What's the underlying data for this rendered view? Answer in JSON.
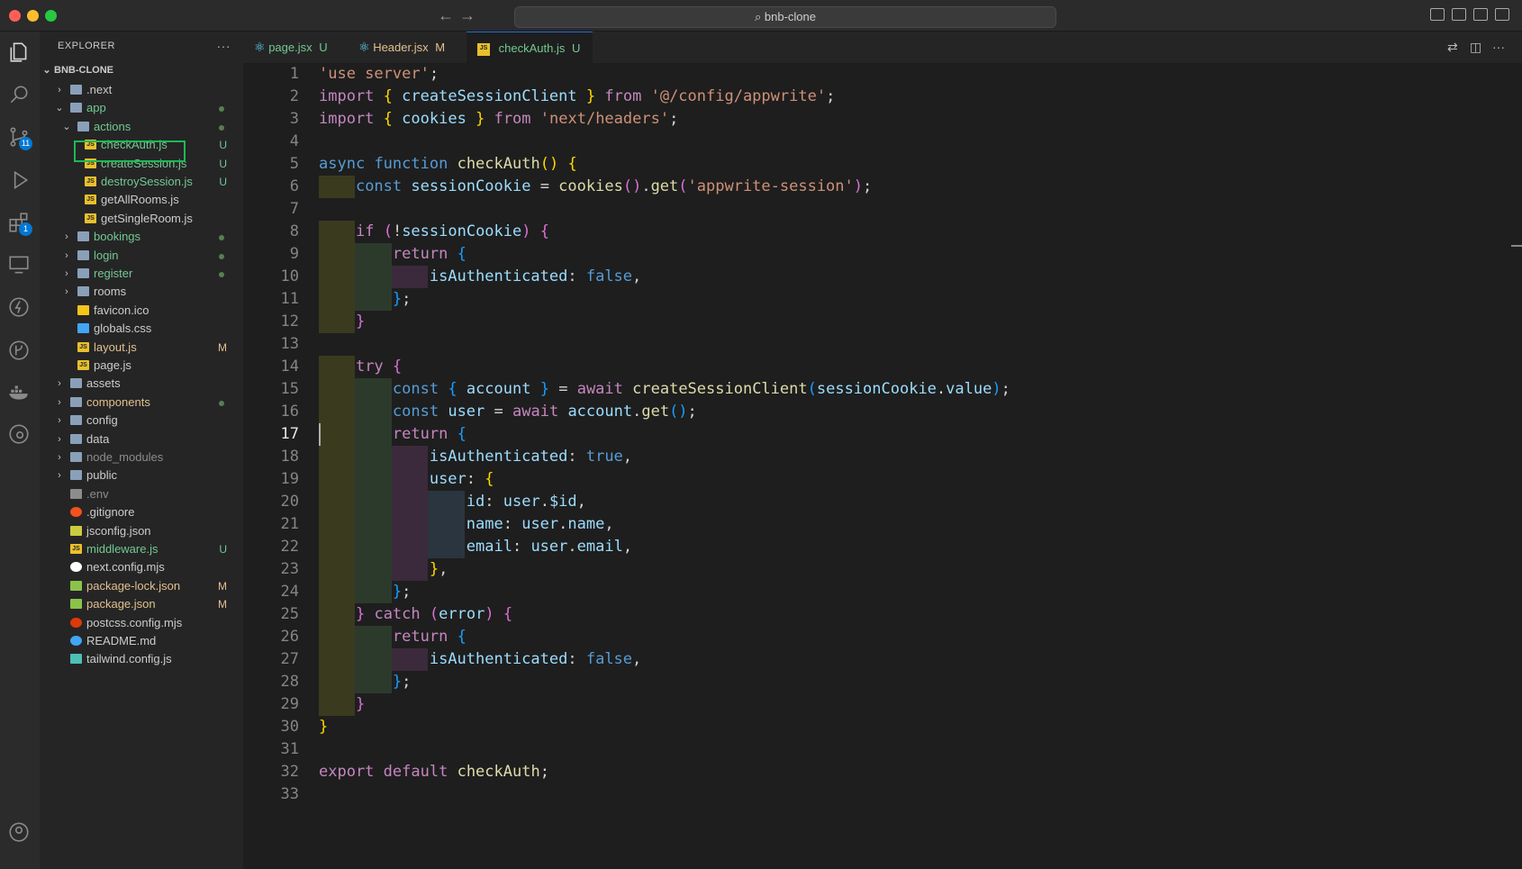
{
  "window": {
    "title": "bnb-clone"
  },
  "explorer": {
    "header": "EXPLORER",
    "more": "···",
    "root": "BNB-CLONE",
    "items": [
      {
        "label": ".next",
        "level": 1,
        "type": "folder",
        "open": false,
        "status": "",
        "dot": false,
        "color": "#cccccc"
      },
      {
        "label": "app",
        "level": 1,
        "type": "folder",
        "open": true,
        "status": "",
        "dot": true,
        "color": "#73c991"
      },
      {
        "label": "actions",
        "level": 2,
        "type": "folder",
        "open": true,
        "status": "",
        "dot": true,
        "color": "#73c991"
      },
      {
        "label": "checkAuth.js",
        "level": 3,
        "type": "js",
        "status": "U",
        "dot": false,
        "color": "#73c991",
        "selected": true
      },
      {
        "label": "createSession.js",
        "level": 3,
        "type": "js",
        "status": "U",
        "dot": false,
        "color": "#73c991"
      },
      {
        "label": "destroySession.js",
        "level": 3,
        "type": "js",
        "status": "U",
        "dot": false,
        "color": "#73c991"
      },
      {
        "label": "getAllRooms.js",
        "level": 3,
        "type": "js",
        "status": "",
        "dot": false,
        "color": "#cccccc"
      },
      {
        "label": "getSingleRoom.js",
        "level": 3,
        "type": "js",
        "status": "",
        "dot": false,
        "color": "#cccccc"
      },
      {
        "label": "bookings",
        "level": 2,
        "type": "folder",
        "open": false,
        "status": "",
        "dot": true,
        "color": "#73c991"
      },
      {
        "label": "login",
        "level": 2,
        "type": "folder",
        "open": false,
        "status": "",
        "dot": true,
        "color": "#73c991"
      },
      {
        "label": "register",
        "level": 2,
        "type": "folder",
        "open": false,
        "status": "",
        "dot": true,
        "color": "#73c991"
      },
      {
        "label": "rooms",
        "level": 2,
        "type": "folder",
        "open": false,
        "status": "",
        "dot": false,
        "color": "#cccccc"
      },
      {
        "label": "favicon.ico",
        "level": 2,
        "type": "star",
        "status": "",
        "dot": false,
        "color": "#cccccc"
      },
      {
        "label": "globals.css",
        "level": 2,
        "type": "css",
        "status": "",
        "dot": false,
        "color": "#cccccc"
      },
      {
        "label": "layout.js",
        "level": 2,
        "type": "js",
        "status": "M",
        "dot": false,
        "color": "#e2c08d"
      },
      {
        "label": "page.js",
        "level": 2,
        "type": "js",
        "status": "",
        "dot": false,
        "color": "#cccccc"
      },
      {
        "label": "assets",
        "level": 1,
        "type": "folder",
        "open": false,
        "status": "",
        "dot": false,
        "color": "#cccccc"
      },
      {
        "label": "components",
        "level": 1,
        "type": "folder",
        "open": false,
        "status": "",
        "dot": true,
        "color": "#e2c08d"
      },
      {
        "label": "config",
        "level": 1,
        "type": "folder",
        "open": false,
        "status": "",
        "dot": false,
        "color": "#cccccc"
      },
      {
        "label": "data",
        "level": 1,
        "type": "folder",
        "open": false,
        "status": "",
        "dot": false,
        "color": "#cccccc"
      },
      {
        "label": "node_modules",
        "level": 1,
        "type": "folder",
        "open": false,
        "status": "",
        "dot": false,
        "color": "#8c8c8c"
      },
      {
        "label": "public",
        "level": 1,
        "type": "folder",
        "open": false,
        "status": "",
        "dot": false,
        "color": "#cccccc"
      },
      {
        "label": ".env",
        "level": 1,
        "type": "env",
        "status": "",
        "dot": false,
        "color": "#8c8c8c"
      },
      {
        "label": ".gitignore",
        "level": 1,
        "type": "git",
        "status": "",
        "dot": false,
        "color": "#cccccc"
      },
      {
        "label": "jsconfig.json",
        "level": 1,
        "type": "json",
        "status": "",
        "dot": false,
        "color": "#cccccc"
      },
      {
        "label": "middleware.js",
        "level": 1,
        "type": "js",
        "status": "U",
        "dot": false,
        "color": "#73c991"
      },
      {
        "label": "next.config.mjs",
        "level": 1,
        "type": "next",
        "status": "",
        "dot": false,
        "color": "#cccccc"
      },
      {
        "label": "package-lock.json",
        "level": 1,
        "type": "pkg",
        "status": "M",
        "dot": false,
        "color": "#e2c08d"
      },
      {
        "label": "package.json",
        "level": 1,
        "type": "pkg",
        "status": "M",
        "dot": false,
        "color": "#e2c08d"
      },
      {
        "label": "postcss.config.mjs",
        "level": 1,
        "type": "postcss",
        "status": "",
        "dot": false,
        "color": "#cccccc"
      },
      {
        "label": "README.md",
        "level": 1,
        "type": "info",
        "status": "",
        "dot": false,
        "color": "#cccccc"
      },
      {
        "label": "tailwind.config.js",
        "level": 1,
        "type": "tailwind",
        "status": "",
        "dot": false,
        "color": "#cccccc"
      }
    ]
  },
  "activity": {
    "scm_badge": "11",
    "extensions_badge": "1"
  },
  "tabs": [
    {
      "label": "page.jsx",
      "status": "U",
      "icon": "react-icon",
      "color": "#73c991",
      "active": false
    },
    {
      "label": "Header.jsx",
      "status": "M",
      "icon": "react-icon",
      "color": "#e2c08d",
      "active": false
    },
    {
      "label": "checkAuth.js",
      "status": "U",
      "icon": "js-icon",
      "color": "#73c991",
      "active": true,
      "close": "✕"
    }
  ],
  "editor": {
    "current_line": 17,
    "lines": [
      [
        [
          "str",
          "'use server'"
        ],
        [
          "plain",
          ";"
        ]
      ],
      [
        [
          "kw",
          "import"
        ],
        [
          "plain",
          " "
        ],
        [
          "br1",
          "{"
        ],
        [
          "plain",
          " "
        ],
        [
          "var",
          "createSessionClient"
        ],
        [
          "plain",
          " "
        ],
        [
          "br1",
          "}"
        ],
        [
          "plain",
          " "
        ],
        [
          "kw",
          "from"
        ],
        [
          "plain",
          " "
        ],
        [
          "str",
          "'@/config/appwrite'"
        ],
        [
          "plain",
          ";"
        ]
      ],
      [
        [
          "kw",
          "import"
        ],
        [
          "plain",
          " "
        ],
        [
          "br1",
          "{"
        ],
        [
          "plain",
          " "
        ],
        [
          "var",
          "cookies"
        ],
        [
          "plain",
          " "
        ],
        [
          "br1",
          "}"
        ],
        [
          "plain",
          " "
        ],
        [
          "kw",
          "from"
        ],
        [
          "plain",
          " "
        ],
        [
          "str",
          "'next/headers'"
        ],
        [
          "plain",
          ";"
        ]
      ],
      [],
      [
        [
          "kw2",
          "async"
        ],
        [
          "plain",
          " "
        ],
        [
          "kw2",
          "function"
        ],
        [
          "plain",
          " "
        ],
        [
          "fn",
          "checkAuth"
        ],
        [
          "br1",
          "()"
        ],
        [
          "plain",
          " "
        ],
        [
          "br1",
          "{"
        ]
      ],
      [
        [
          "plain",
          "  "
        ],
        [
          "kw2",
          "const"
        ],
        [
          "plain",
          " "
        ],
        [
          "var",
          "sessionCookie"
        ],
        [
          "plain",
          " = "
        ],
        [
          "fn",
          "cookies"
        ],
        [
          "br2",
          "()"
        ],
        [
          "plain",
          "."
        ],
        [
          "fn",
          "get"
        ],
        [
          "br2",
          "("
        ],
        [
          "str",
          "'appwrite-session'"
        ],
        [
          "br2",
          ")"
        ],
        [
          "plain",
          ";"
        ]
      ],
      [],
      [
        [
          "plain",
          "  "
        ],
        [
          "kw",
          "if"
        ],
        [
          "plain",
          " "
        ],
        [
          "br2",
          "("
        ],
        [
          "plain",
          "!"
        ],
        [
          "var",
          "sessionCookie"
        ],
        [
          "br2",
          ")"
        ],
        [
          "plain",
          " "
        ],
        [
          "br2",
          "{"
        ]
      ],
      [
        [
          "plain",
          "    "
        ],
        [
          "kw",
          "return"
        ],
        [
          "plain",
          " "
        ],
        [
          "br3",
          "{"
        ]
      ],
      [
        [
          "plain",
          "      "
        ],
        [
          "prop",
          "isAuthenticated"
        ],
        [
          "plain",
          ": "
        ],
        [
          "kw2",
          "false"
        ],
        [
          "plain",
          ","
        ]
      ],
      [
        [
          "plain",
          "    "
        ],
        [
          "br3",
          "}"
        ],
        [
          "plain",
          ";"
        ]
      ],
      [
        [
          "plain",
          "  "
        ],
        [
          "br2",
          "}"
        ]
      ],
      [],
      [
        [
          "plain",
          "  "
        ],
        [
          "kw",
          "try"
        ],
        [
          "plain",
          " "
        ],
        [
          "br2",
          "{"
        ]
      ],
      [
        [
          "plain",
          "    "
        ],
        [
          "kw2",
          "const"
        ],
        [
          "plain",
          " "
        ],
        [
          "br3",
          "{"
        ],
        [
          "plain",
          " "
        ],
        [
          "var",
          "account"
        ],
        [
          "plain",
          " "
        ],
        [
          "br3",
          "}"
        ],
        [
          "plain",
          " = "
        ],
        [
          "kw",
          "await"
        ],
        [
          "plain",
          " "
        ],
        [
          "fn",
          "createSessionClient"
        ],
        [
          "br3",
          "("
        ],
        [
          "var",
          "sessionCookie"
        ],
        [
          "plain",
          "."
        ],
        [
          "prop",
          "value"
        ],
        [
          "br3",
          ")"
        ],
        [
          "plain",
          ";"
        ]
      ],
      [
        [
          "plain",
          "    "
        ],
        [
          "kw2",
          "const"
        ],
        [
          "plain",
          " "
        ],
        [
          "var",
          "user"
        ],
        [
          "plain",
          " = "
        ],
        [
          "kw",
          "await"
        ],
        [
          "plain",
          " "
        ],
        [
          "var",
          "account"
        ],
        [
          "plain",
          "."
        ],
        [
          "fn",
          "get"
        ],
        [
          "br3",
          "()"
        ],
        [
          "plain",
          ";"
        ]
      ],
      [
        [
          "plain",
          "    "
        ],
        [
          "kw",
          "return"
        ],
        [
          "plain",
          " "
        ],
        [
          "br3",
          "{"
        ]
      ],
      [
        [
          "plain",
          "      "
        ],
        [
          "prop",
          "isAuthenticated"
        ],
        [
          "plain",
          ": "
        ],
        [
          "kw2",
          "true"
        ],
        [
          "plain",
          ","
        ]
      ],
      [
        [
          "plain",
          "      "
        ],
        [
          "prop",
          "user"
        ],
        [
          "plain",
          ": "
        ],
        [
          "br1",
          "{"
        ]
      ],
      [
        [
          "plain",
          "        "
        ],
        [
          "prop",
          "id"
        ],
        [
          "plain",
          ": "
        ],
        [
          "var",
          "user"
        ],
        [
          "plain",
          "."
        ],
        [
          "prop",
          "$id"
        ],
        [
          "plain",
          ","
        ]
      ],
      [
        [
          "plain",
          "        "
        ],
        [
          "prop",
          "name"
        ],
        [
          "plain",
          ": "
        ],
        [
          "var",
          "user"
        ],
        [
          "plain",
          "."
        ],
        [
          "prop",
          "name"
        ],
        [
          "plain",
          ","
        ]
      ],
      [
        [
          "plain",
          "        "
        ],
        [
          "prop",
          "email"
        ],
        [
          "plain",
          ": "
        ],
        [
          "var",
          "user"
        ],
        [
          "plain",
          "."
        ],
        [
          "prop",
          "email"
        ],
        [
          "plain",
          ","
        ]
      ],
      [
        [
          "plain",
          "      "
        ],
        [
          "br1",
          "}"
        ],
        [
          "plain",
          ","
        ]
      ],
      [
        [
          "plain",
          "    "
        ],
        [
          "br3",
          "}"
        ],
        [
          "plain",
          ";"
        ]
      ],
      [
        [
          "plain",
          "  "
        ],
        [
          "br2",
          "}"
        ],
        [
          "plain",
          " "
        ],
        [
          "kw",
          "catch"
        ],
        [
          "plain",
          " "
        ],
        [
          "br2",
          "("
        ],
        [
          "var",
          "error"
        ],
        [
          "br2",
          ")"
        ],
        [
          "plain",
          " "
        ],
        [
          "br2",
          "{"
        ]
      ],
      [
        [
          "plain",
          "    "
        ],
        [
          "kw",
          "return"
        ],
        [
          "plain",
          " "
        ],
        [
          "br3",
          "{"
        ]
      ],
      [
        [
          "plain",
          "      "
        ],
        [
          "prop",
          "isAuthenticated"
        ],
        [
          "plain",
          ": "
        ],
        [
          "kw2",
          "false"
        ],
        [
          "plain",
          ","
        ]
      ],
      [
        [
          "plain",
          "    "
        ],
        [
          "br3",
          "}"
        ],
        [
          "plain",
          ";"
        ]
      ],
      [
        [
          "plain",
          "  "
        ],
        [
          "br2",
          "}"
        ]
      ],
      [
        [
          "br1",
          "}"
        ]
      ],
      [],
      [
        [
          "kw",
          "export"
        ],
        [
          "plain",
          " "
        ],
        [
          "kw",
          "default"
        ],
        [
          "plain",
          " "
        ],
        [
          "fn",
          "checkAuth"
        ],
        [
          "plain",
          ";"
        ]
      ],
      []
    ]
  }
}
